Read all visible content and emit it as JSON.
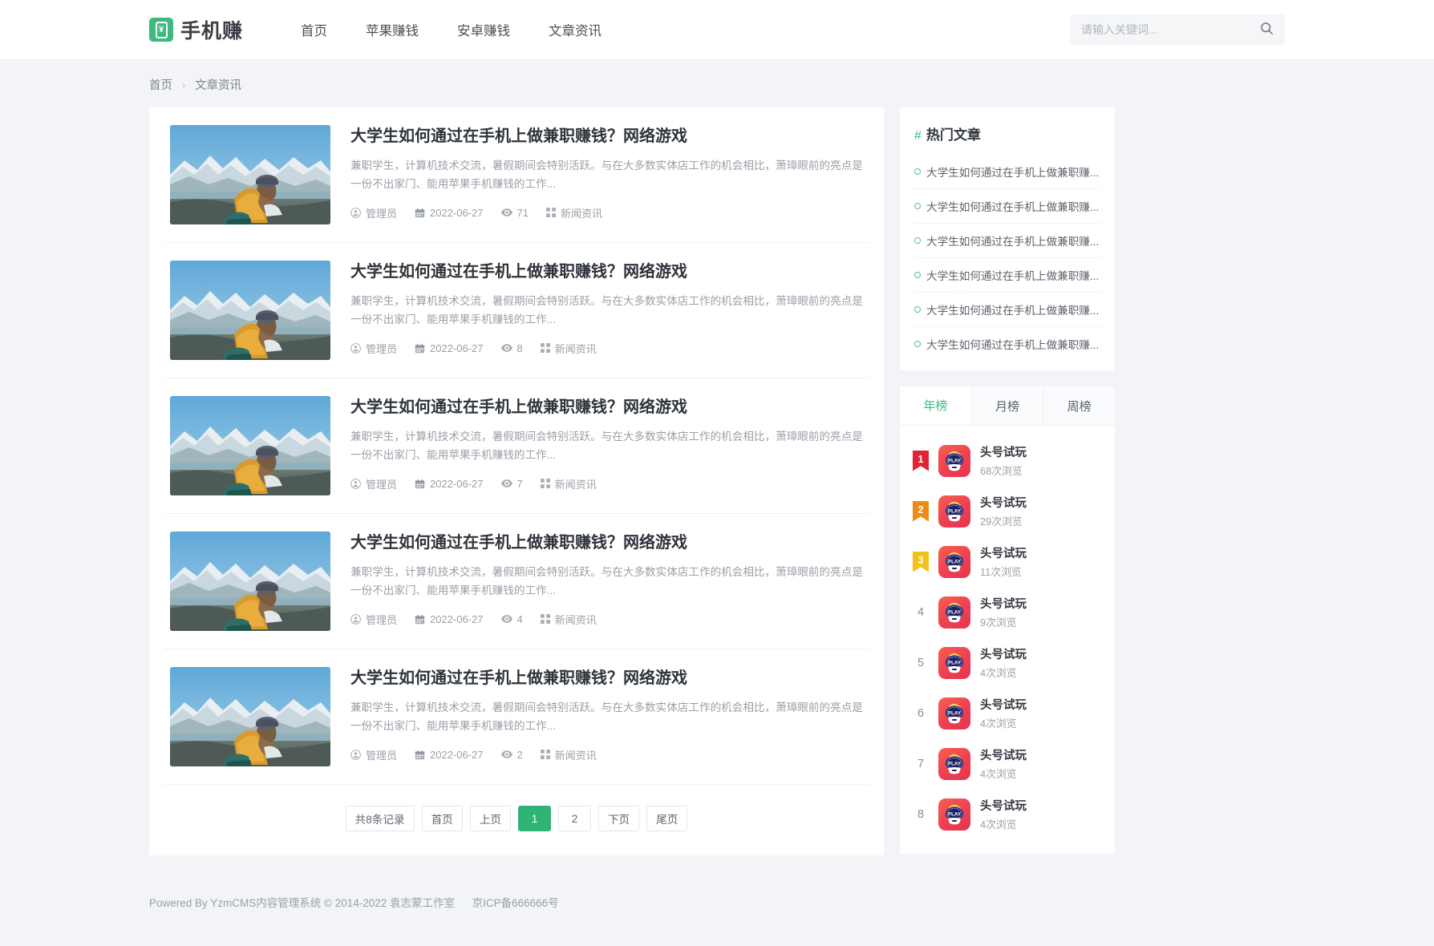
{
  "site": {
    "logo_text": "手机赚",
    "logo_symbol": "¥"
  },
  "nav": {
    "items": [
      {
        "label": "首页"
      },
      {
        "label": "苹果赚钱"
      },
      {
        "label": "安卓赚钱"
      },
      {
        "label": "文章资讯"
      }
    ]
  },
  "search": {
    "placeholder": "请输入关键词...",
    "value": "",
    "icon": "search-icon"
  },
  "breadcrumb": {
    "home": "首页",
    "separator": "›",
    "current": "文章资讯"
  },
  "articles": [
    {
      "title": "大学生如何通过在手机上做兼职赚钱？网络游戏",
      "excerpt": "兼职学生，计算机技术交流，暑假期间会特别活跃。与在大多数实体店工作的机会相比，萧璋眼前的亮点是一份不出家门、能用苹果手机赚钱的工作...",
      "author": "管理员",
      "date": "2022-06-27",
      "views": "71",
      "category": "新闻资讯"
    },
    {
      "title": "大学生如何通过在手机上做兼职赚钱？网络游戏",
      "excerpt": "兼职学生，计算机技术交流，暑假期间会特别活跃。与在大多数实体店工作的机会相比，萧璋眼前的亮点是一份不出家门、能用苹果手机赚钱的工作...",
      "author": "管理员",
      "date": "2022-06-27",
      "views": "8",
      "category": "新闻资讯"
    },
    {
      "title": "大学生如何通过在手机上做兼职赚钱？网络游戏",
      "excerpt": "兼职学生，计算机技术交流，暑假期间会特别活跃。与在大多数实体店工作的机会相比，萧璋眼前的亮点是一份不出家门、能用苹果手机赚钱的工作...",
      "author": "管理员",
      "date": "2022-06-27",
      "views": "7",
      "category": "新闻资讯"
    },
    {
      "title": "大学生如何通过在手机上做兼职赚钱？网络游戏",
      "excerpt": "兼职学生，计算机技术交流，暑假期间会特别活跃。与在大多数实体店工作的机会相比，萧璋眼前的亮点是一份不出家门、能用苹果手机赚钱的工作...",
      "author": "管理员",
      "date": "2022-06-27",
      "views": "4",
      "category": "新闻资讯"
    },
    {
      "title": "大学生如何通过在手机上做兼职赚钱？网络游戏",
      "excerpt": "兼职学生，计算机技术交流，暑假期间会特别活跃。与在大多数实体店工作的机会相比，萧璋眼前的亮点是一份不出家门、能用苹果手机赚钱的工作...",
      "author": "管理员",
      "date": "2022-06-27",
      "views": "2",
      "category": "新闻资讯"
    }
  ],
  "pagination": {
    "total_label": "共8条记录",
    "total_count": "8",
    "total_prefix": "共",
    "total_suffix": "条记录",
    "first": "首页",
    "prev": "上页",
    "pages": [
      "1",
      "2"
    ],
    "active_page": "1",
    "next": "下页",
    "last": "尾页"
  },
  "hot_articles": {
    "title": "热门文章",
    "hash": "#",
    "items": [
      {
        "label": "大学生如何通过在手机上做兼职赚..."
      },
      {
        "label": "大学生如何通过在手机上做兼职赚..."
      },
      {
        "label": "大学生如何通过在手机上做兼职赚..."
      },
      {
        "label": "大学生如何通过在手机上做兼职赚..."
      },
      {
        "label": "大学生如何通过在手机上做兼职赚..."
      },
      {
        "label": "大学生如何通过在手机上做兼职赚..."
      }
    ]
  },
  "ranking": {
    "tabs": [
      {
        "label": "年榜",
        "active": true
      },
      {
        "label": "月榜",
        "active": false
      },
      {
        "label": "周榜",
        "active": false
      }
    ],
    "items": [
      {
        "rank": "1",
        "name": "头号试玩",
        "views": "68次浏览",
        "badge": "ribbon"
      },
      {
        "rank": "2",
        "name": "头号试玩",
        "views": "29次浏览",
        "badge": "ribbon"
      },
      {
        "rank": "3",
        "name": "头号试玩",
        "views": "11次浏览",
        "badge": "ribbon"
      },
      {
        "rank": "4",
        "name": "头号试玩",
        "views": "9次浏览",
        "badge": "plain"
      },
      {
        "rank": "5",
        "name": "头号试玩",
        "views": "4次浏览",
        "badge": "plain"
      },
      {
        "rank": "6",
        "name": "头号试玩",
        "views": "4次浏览",
        "badge": "plain"
      },
      {
        "rank": "7",
        "name": "头号试玩",
        "views": "4次浏览",
        "badge": "plain"
      },
      {
        "rank": "8",
        "name": "头号试玩",
        "views": "4次浏览",
        "badge": "plain"
      }
    ],
    "app_icon_text": "PLAY"
  },
  "footer": {
    "powered": "Powered By YzmCMS内容管理系统 © 2014-2022 袁志蒙工作室",
    "icp": "京ICP备666666号"
  },
  "colors": {
    "accent_green": "#3dba7e",
    "pager_active": "#30b476",
    "rank1": "#e02433",
    "rank2": "#f08a14",
    "rank3": "#f2c21a",
    "app_red": "#ee3f53"
  }
}
